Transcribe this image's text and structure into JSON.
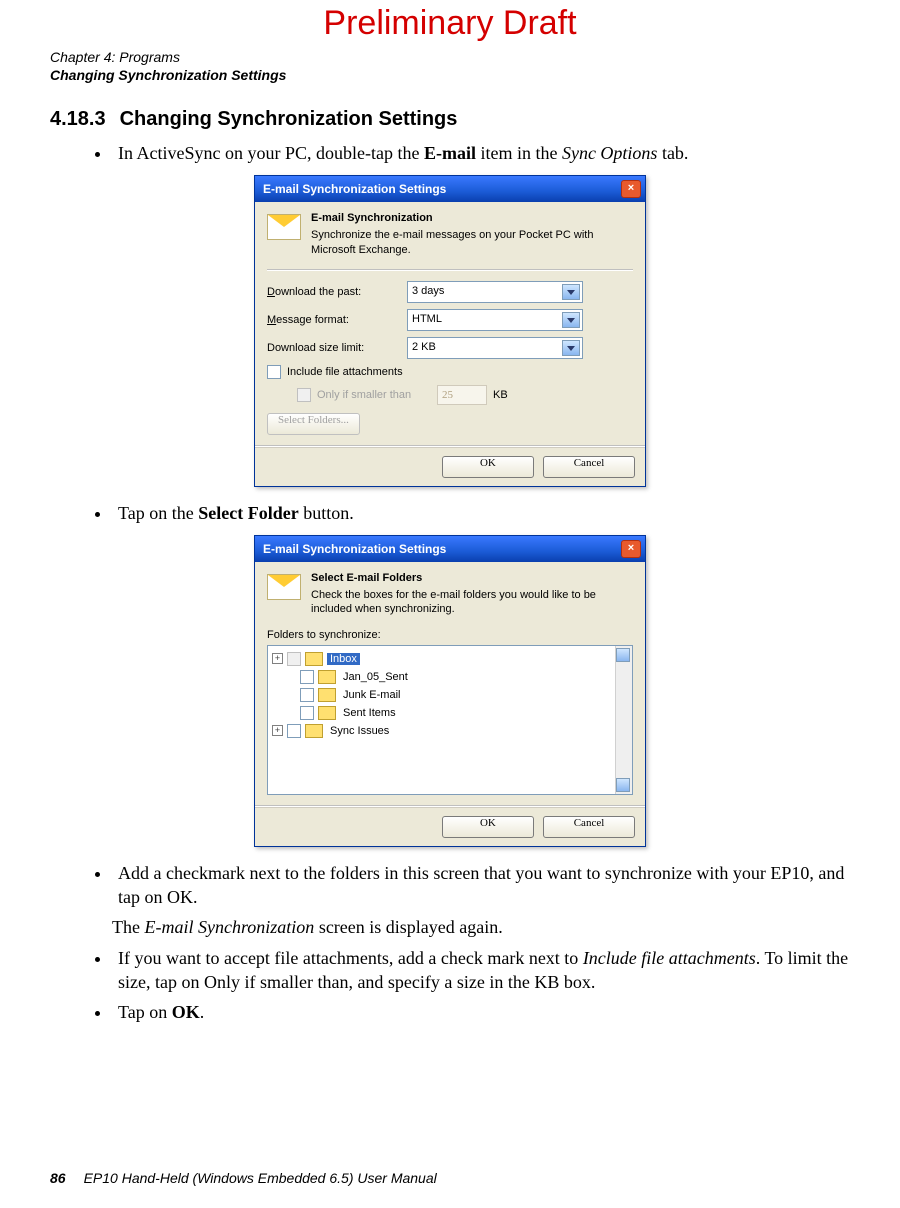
{
  "watermark": "Preliminary Draft",
  "header": {
    "line1": "Chapter 4: Programs",
    "line2": "Changing Synchronization Settings"
  },
  "section": {
    "number": "4.18.3",
    "title": "Changing Synchronization Settings"
  },
  "bullets": {
    "b1_pre": "In ActiveSync on your PC, double-tap the ",
    "b1_bold": "E-mail",
    "b1_mid": " item in the ",
    "b1_italic": "Sync Options",
    "b1_post": " tab.",
    "b2_pre": "Tap on the ",
    "b2_bold": "Select Folder",
    "b2_post": " button.",
    "b3": "Add a checkmark next to the folders in this screen that you want to synchronize with your EP10, and tap on OK.",
    "p_mid_pre": "The ",
    "p_mid_italic": "E-mail Synchronization",
    "p_mid_post": " screen is displayed again.",
    "b4_pre": "If you want to accept file attachments, add a check mark next to ",
    "b4_italic": "Include file attach­ments",
    "b4_post": ". To limit the size, tap on Only if smaller than, and specify a size in the KB box.",
    "b5_pre": "Tap on ",
    "b5_bold": "OK",
    "b5_post": "."
  },
  "dialog1": {
    "title": "E-mail Synchronization Settings",
    "heading": "E-mail Synchronization",
    "subtext": "Synchronize the e-mail messages on your Pocket PC with Microsoft Exchange.",
    "lbl_download_past": "Download the past:",
    "val_download_past": "3 days",
    "lbl_msg_format": "Message format:",
    "val_msg_format": "HTML",
    "lbl_size_limit": "Download size limit:",
    "val_size_limit": "2 KB",
    "chk_include": "Include file attachments",
    "chk_only_label": "Only if smaller than",
    "kb_value": "25",
    "kb_unit": "KB",
    "btn_select_folders": "Select Folders...",
    "btn_ok": "OK",
    "btn_cancel": "Cancel"
  },
  "dialog2": {
    "title": "E-mail Synchronization Settings",
    "heading": "Select E-mail Folders",
    "subtext": "Check the boxes for the e-mail folders you would like to be included when synchronizing.",
    "lbl_folders": "Folders to synchronize:",
    "tree": {
      "inbox": "Inbox",
      "jan": "Jan_05_Sent",
      "junk": "Junk E-mail",
      "sent": "Sent Items",
      "sync": "Sync Issues"
    },
    "btn_ok": "OK",
    "btn_cancel": "Cancel"
  },
  "footer": {
    "pagenum": "86",
    "text": "EP10 Hand-Held (Windows Embedded 6.5) User Manual"
  }
}
